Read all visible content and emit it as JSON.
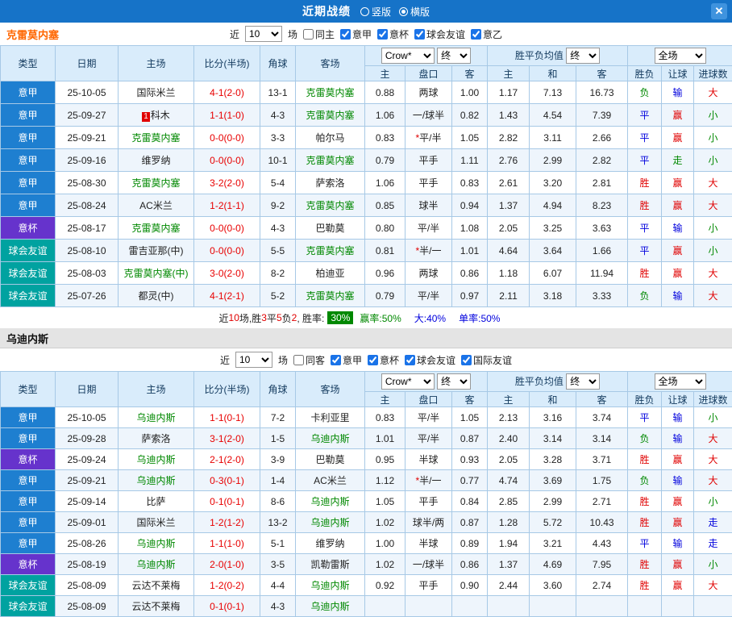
{
  "colors": {
    "red": "#e00000",
    "green": "#008800",
    "blue": "#0000dd",
    "league": {
      "意甲": "#1e7fd0",
      "意杯": "#6633cc",
      "球会友谊": "#00a2a0"
    }
  },
  "titlebar": {
    "title": "近期战绩",
    "radio_vertical": "竖版",
    "radio_horizontal": "横版",
    "close": "✕"
  },
  "filters_common": {
    "near_label": "近",
    "near_value": "10",
    "matches_label": "场"
  },
  "table_headers": {
    "type": "类型",
    "date": "日期",
    "home": "主场",
    "score": "比分(半场)",
    "corner": "角球",
    "away": "客场",
    "odds_select": "Crow*",
    "final_label": "终",
    "mean_label": "胜平负均值",
    "scope_select": "全场",
    "odds_home": "主",
    "odds_handicap": "盘口",
    "odds_away": "客",
    "mean_home": "主",
    "mean_draw": "和",
    "mean_away": "客",
    "res_wdl": "胜负",
    "res_handicap": "让球",
    "res_goals": "进球数"
  },
  "sections": [
    {
      "team": "克雷莫内塞",
      "filter": {
        "same_label": "同主",
        "same_checked": false,
        "leagues": [
          {
            "label": "意甲",
            "checked": true
          },
          {
            "label": "意杯",
            "checked": true
          },
          {
            "label": "球会友谊",
            "checked": true
          },
          {
            "label": "意乙",
            "checked": true
          }
        ]
      },
      "rows": [
        {
          "league": "意甲",
          "date": "25-10-05",
          "home": "国际米兰",
          "home_green": false,
          "score": "4-1(2-0)",
          "corner": "13-1",
          "away": "克雷莫内塞",
          "away_green": true,
          "odds": [
            "0.88",
            "两球",
            "1.00"
          ],
          "mean": [
            "1.17",
            "7.13",
            "16.73"
          ],
          "results": [
            "负",
            "输",
            "大"
          ],
          "result_colors": [
            "g",
            "b",
            "r"
          ]
        },
        {
          "league": "意甲",
          "date": "25-09-27",
          "home": "科木",
          "home_badge": "1",
          "home_green": false,
          "score": "1-1(1-0)",
          "corner": "4-3",
          "away": "克雷莫内塞",
          "away_green": true,
          "odds": [
            "1.06",
            "一/球半",
            "0.82"
          ],
          "mean": [
            "1.43",
            "4.54",
            "7.39"
          ],
          "results": [
            "平",
            "赢",
            "小"
          ],
          "result_colors": [
            "b",
            "r",
            "g"
          ]
        },
        {
          "league": "意甲",
          "date": "25-09-21",
          "home": "克雷莫内塞",
          "home_green": true,
          "score": "0-0(0-0)",
          "corner": "3-3",
          "away": "帕尔马",
          "away_green": false,
          "odds": [
            "0.83",
            "*平/半",
            "1.05"
          ],
          "mean": [
            "2.82",
            "3.11",
            "2.66"
          ],
          "results": [
            "平",
            "赢",
            "小"
          ],
          "result_colors": [
            "b",
            "r",
            "g"
          ]
        },
        {
          "league": "意甲",
          "date": "25-09-16",
          "home": "维罗纳",
          "home_green": false,
          "score": "0-0(0-0)",
          "corner": "10-1",
          "away": "克雷莫内塞",
          "away_green": true,
          "odds": [
            "0.79",
            "平手",
            "1.11"
          ],
          "mean": [
            "2.76",
            "2.99",
            "2.82"
          ],
          "results": [
            "平",
            "走",
            "小"
          ],
          "result_colors": [
            "b",
            "g",
            "g"
          ]
        },
        {
          "league": "意甲",
          "date": "25-08-30",
          "home": "克雷莫内塞",
          "home_green": true,
          "score": "3-2(2-0)",
          "corner": "5-4",
          "away": "萨索洛",
          "away_green": false,
          "odds": [
            "1.06",
            "平手",
            "0.83"
          ],
          "mean": [
            "2.61",
            "3.20",
            "2.81"
          ],
          "results": [
            "胜",
            "赢",
            "大"
          ],
          "result_colors": [
            "r",
            "r",
            "r"
          ]
        },
        {
          "league": "意甲",
          "date": "25-08-24",
          "home": "AC米兰",
          "home_green": false,
          "score": "1-2(1-1)",
          "corner": "9-2",
          "away": "克雷莫内塞",
          "away_green": true,
          "odds": [
            "0.85",
            "球半",
            "0.94"
          ],
          "mean": [
            "1.37",
            "4.94",
            "8.23"
          ],
          "results": [
            "胜",
            "赢",
            "大"
          ],
          "result_colors": [
            "r",
            "r",
            "r"
          ]
        },
        {
          "league": "意杯",
          "date": "25-08-17",
          "home": "克雷莫内塞",
          "home_green": true,
          "score": "0-0(0-0)",
          "corner": "4-3",
          "away": "巴勒莫",
          "away_green": false,
          "odds": [
            "0.80",
            "平/半",
            "1.08"
          ],
          "mean": [
            "2.05",
            "3.25",
            "3.63"
          ],
          "results": [
            "平",
            "输",
            "小"
          ],
          "result_colors": [
            "b",
            "b",
            "g"
          ]
        },
        {
          "league": "球会友谊",
          "date": "25-08-10",
          "home": "雷吉亚那(中)",
          "home_green": false,
          "score": "0-0(0-0)",
          "corner": "5-5",
          "away": "克雷莫内塞",
          "away_green": true,
          "odds": [
            "0.81",
            "*半/一",
            "1.01"
          ],
          "mean": [
            "4.64",
            "3.64",
            "1.66"
          ],
          "results": [
            "平",
            "赢",
            "小"
          ],
          "result_colors": [
            "b",
            "r",
            "g"
          ]
        },
        {
          "league": "球会友谊",
          "date": "25-08-03",
          "home": "克雷莫内塞(中)",
          "home_green": true,
          "score": "3-0(2-0)",
          "corner": "8-2",
          "away": "柏迪亚",
          "away_green": false,
          "odds": [
            "0.96",
            "两球",
            "0.86"
          ],
          "mean": [
            "1.18",
            "6.07",
            "11.94"
          ],
          "results": [
            "胜",
            "赢",
            "大"
          ],
          "result_colors": [
            "r",
            "r",
            "r"
          ]
        },
        {
          "league": "球会友谊",
          "date": "25-07-26",
          "home": "都灵(中)",
          "home_green": false,
          "score": "4-1(2-1)",
          "corner": "5-2",
          "away": "克雷莫内塞",
          "away_green": true,
          "odds": [
            "0.79",
            "平/半",
            "0.97"
          ],
          "mean": [
            "2.11",
            "3.18",
            "3.33"
          ],
          "results": [
            "负",
            "输",
            "大"
          ],
          "result_colors": [
            "g",
            "b",
            "r"
          ]
        }
      ],
      "summary": {
        "segments": [
          {
            "t": "近"
          },
          {
            "t": "10",
            "c": "r"
          },
          {
            "t": "场,胜"
          },
          {
            "t": "3",
            "c": "r"
          },
          {
            "t": "平"
          },
          {
            "t": "5",
            "c": "r"
          },
          {
            "t": "负"
          },
          {
            "t": "2",
            "c": "r"
          },
          {
            "t": ", 胜率:"
          }
        ],
        "rate_badge": "30%",
        "tail": [
          {
            "t": "赢率:50%",
            "c": "g"
          },
          {
            "t": "大:40%",
            "c": "b"
          },
          {
            "t": "单率:50%",
            "c": "b"
          }
        ]
      }
    },
    {
      "team": "乌迪内斯",
      "filter": {
        "same_label": "同客",
        "same_checked": false,
        "leagues": [
          {
            "label": "意甲",
            "checked": true
          },
          {
            "label": "意杯",
            "checked": true
          },
          {
            "label": "球会友谊",
            "checked": true
          },
          {
            "label": "国际友谊",
            "checked": true
          }
        ]
      },
      "rows": [
        {
          "league": "意甲",
          "date": "25-10-05",
          "home": "乌迪内斯",
          "home_green": true,
          "score": "1-1(0-1)",
          "corner": "7-2",
          "away": "卡利亚里",
          "away_green": false,
          "odds": [
            "0.83",
            "平/半",
            "1.05"
          ],
          "mean": [
            "2.13",
            "3.16",
            "3.74"
          ],
          "results": [
            "平",
            "输",
            "小"
          ],
          "result_colors": [
            "b",
            "b",
            "g"
          ]
        },
        {
          "league": "意甲",
          "date": "25-09-28",
          "home": "萨索洛",
          "home_green": false,
          "score": "3-1(2-0)",
          "corner": "1-5",
          "away": "乌迪内斯",
          "away_green": true,
          "odds": [
            "1.01",
            "平/半",
            "0.87"
          ],
          "mean": [
            "2.40",
            "3.14",
            "3.14"
          ],
          "results": [
            "负",
            "输",
            "大"
          ],
          "result_colors": [
            "g",
            "b",
            "r"
          ]
        },
        {
          "league": "意杯",
          "date": "25-09-24",
          "home": "乌迪内斯",
          "home_green": true,
          "score": "2-1(2-0)",
          "corner": "3-9",
          "away": "巴勒莫",
          "away_green": false,
          "odds": [
            "0.95",
            "半球",
            "0.93"
          ],
          "mean": [
            "2.05",
            "3.28",
            "3.71"
          ],
          "results": [
            "胜",
            "赢",
            "大"
          ],
          "result_colors": [
            "r",
            "r",
            "r"
          ]
        },
        {
          "league": "意甲",
          "date": "25-09-21",
          "home": "乌迪内斯",
          "home_green": true,
          "score": "0-3(0-1)",
          "corner": "1-4",
          "away": "AC米兰",
          "away_green": false,
          "odds": [
            "1.12",
            "*半/一",
            "0.77"
          ],
          "mean": [
            "4.74",
            "3.69",
            "1.75"
          ],
          "results": [
            "负",
            "输",
            "大"
          ],
          "result_colors": [
            "g",
            "b",
            "r"
          ]
        },
        {
          "league": "意甲",
          "date": "25-09-14",
          "home": "比萨",
          "home_green": false,
          "score": "0-1(0-1)",
          "corner": "8-6",
          "away": "乌迪内斯",
          "away_green": true,
          "odds": [
            "1.05",
            "平手",
            "0.84"
          ],
          "mean": [
            "2.85",
            "2.99",
            "2.71"
          ],
          "results": [
            "胜",
            "赢",
            "小"
          ],
          "result_colors": [
            "r",
            "r",
            "g"
          ]
        },
        {
          "league": "意甲",
          "date": "25-09-01",
          "home": "国际米兰",
          "home_green": false,
          "score": "1-2(1-2)",
          "corner": "13-2",
          "away": "乌迪内斯",
          "away_green": true,
          "odds": [
            "1.02",
            "球半/两",
            "0.87"
          ],
          "mean": [
            "1.28",
            "5.72",
            "10.43"
          ],
          "results": [
            "胜",
            "赢",
            "走"
          ],
          "result_colors": [
            "r",
            "r",
            "b"
          ]
        },
        {
          "league": "意甲",
          "date": "25-08-26",
          "home": "乌迪内斯",
          "home_green": true,
          "score": "1-1(1-0)",
          "corner": "5-1",
          "away": "维罗纳",
          "away_green": false,
          "odds": [
            "1.00",
            "半球",
            "0.89"
          ],
          "mean": [
            "1.94",
            "3.21",
            "4.43"
          ],
          "results": [
            "平",
            "输",
            "走"
          ],
          "result_colors": [
            "b",
            "b",
            "b"
          ]
        },
        {
          "league": "意杯",
          "date": "25-08-19",
          "home": "乌迪内斯",
          "home_green": true,
          "score": "2-0(1-0)",
          "corner": "3-5",
          "away": "凯勒雷斯",
          "away_green": false,
          "odds": [
            "1.02",
            "一/球半",
            "0.86"
          ],
          "mean": [
            "1.37",
            "4.69",
            "7.95"
          ],
          "results": [
            "胜",
            "赢",
            "小"
          ],
          "result_colors": [
            "r",
            "r",
            "g"
          ]
        },
        {
          "league": "球会友谊",
          "date": "25-08-09",
          "home": "云达不莱梅",
          "home_green": false,
          "score": "1-2(0-2)",
          "corner": "4-4",
          "away": "乌迪内斯",
          "away_green": true,
          "odds": [
            "0.92",
            "平手",
            "0.90"
          ],
          "mean": [
            "2.44",
            "3.60",
            "2.74"
          ],
          "results": [
            "胜",
            "赢",
            "大"
          ],
          "result_colors": [
            "r",
            "r",
            "r"
          ]
        },
        {
          "league": "球会友谊",
          "date": "25-08-09",
          "home": "云达不莱梅",
          "home_green": false,
          "score": "0-1(0-1)",
          "corner": "4-3",
          "away": "乌迪内斯",
          "away_green": true,
          "odds": [
            "",
            "",
            ""
          ],
          "mean": [
            "",
            "",
            ""
          ],
          "results": [
            "",
            "",
            ""
          ],
          "result_colors": [
            "",
            "",
            ""
          ]
        }
      ]
    }
  ]
}
